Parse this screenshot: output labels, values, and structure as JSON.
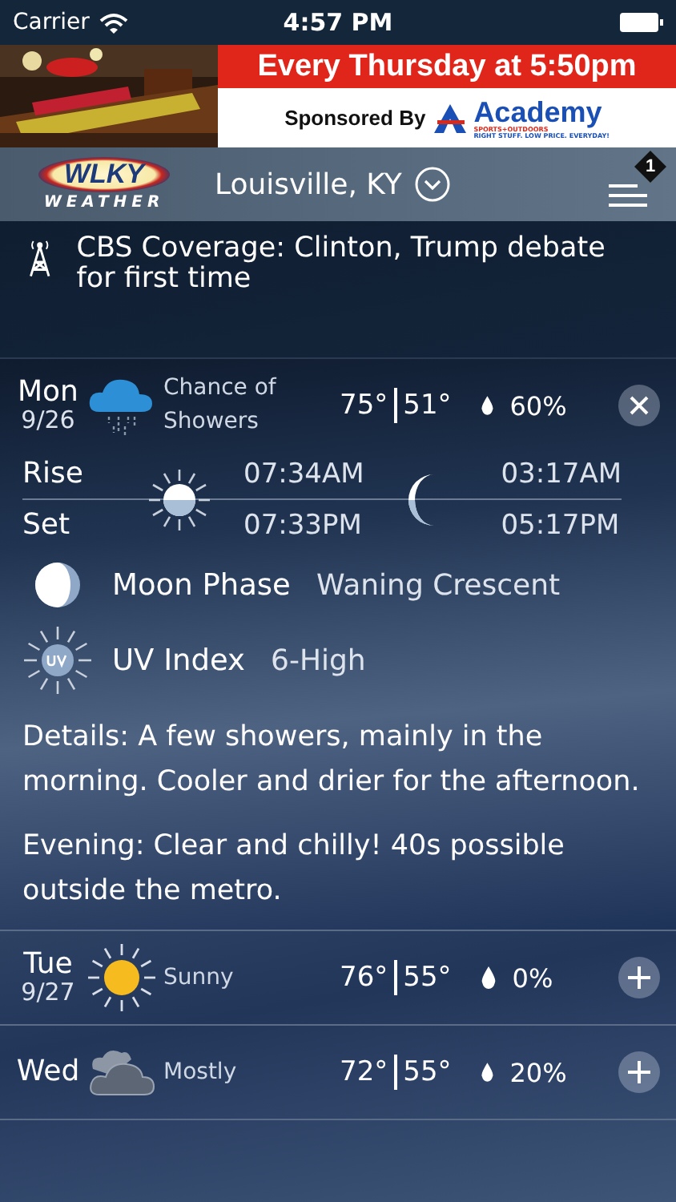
{
  "status_bar": {
    "carrier": "Carrier",
    "time": "4:57 PM"
  },
  "ad": {
    "headline": "Every Thursday at 5:50pm",
    "sponsor_label": "Sponsored By",
    "brand": "Academy",
    "brand_sub": "SPORTS+OUTDOORS",
    "tagline": "RIGHT STUFF. LOW PRICE. EVERYDAY!"
  },
  "header": {
    "logo_top": "WLKY",
    "logo_bottom": "WEATHER",
    "location": "Louisville, KY",
    "badge": "1"
  },
  "news": {
    "text": "CBS Coverage: Clinton, Trump debate for first time"
  },
  "days": [
    {
      "day": "Mon",
      "date": "9/26",
      "kind": "rain",
      "condition": "Chance of Showers",
      "high": "75°",
      "low": "51°",
      "precip": "60%",
      "expanded": true,
      "detail": {
        "rise_label": "Rise",
        "set_label": "Set",
        "sunrise": "07:34AM",
        "sunset": "07:33PM",
        "moonrise": "03:17AM",
        "moonset": "05:17PM",
        "moon_phase_label": "Moon Phase",
        "moon_phase": "Waning Crescent",
        "uv_label": "UV Index",
        "uv_value": "6-High",
        "paragraphs": [
          "Details: A few showers, mainly in the morning. Cooler and drier for the afternoon.",
          "Evening: Clear and chilly! 40s possible outside the metro."
        ]
      }
    },
    {
      "day": "Tue",
      "date": "9/27",
      "kind": "sun",
      "condition": "Sunny",
      "high": "76°",
      "low": "55°",
      "precip": "0%",
      "expanded": false
    },
    {
      "day": "Wed",
      "kind": "cloud",
      "condition": "Mostly",
      "high": "72°",
      "low": "55°",
      "precip": "20%",
      "expanded": false
    }
  ]
}
